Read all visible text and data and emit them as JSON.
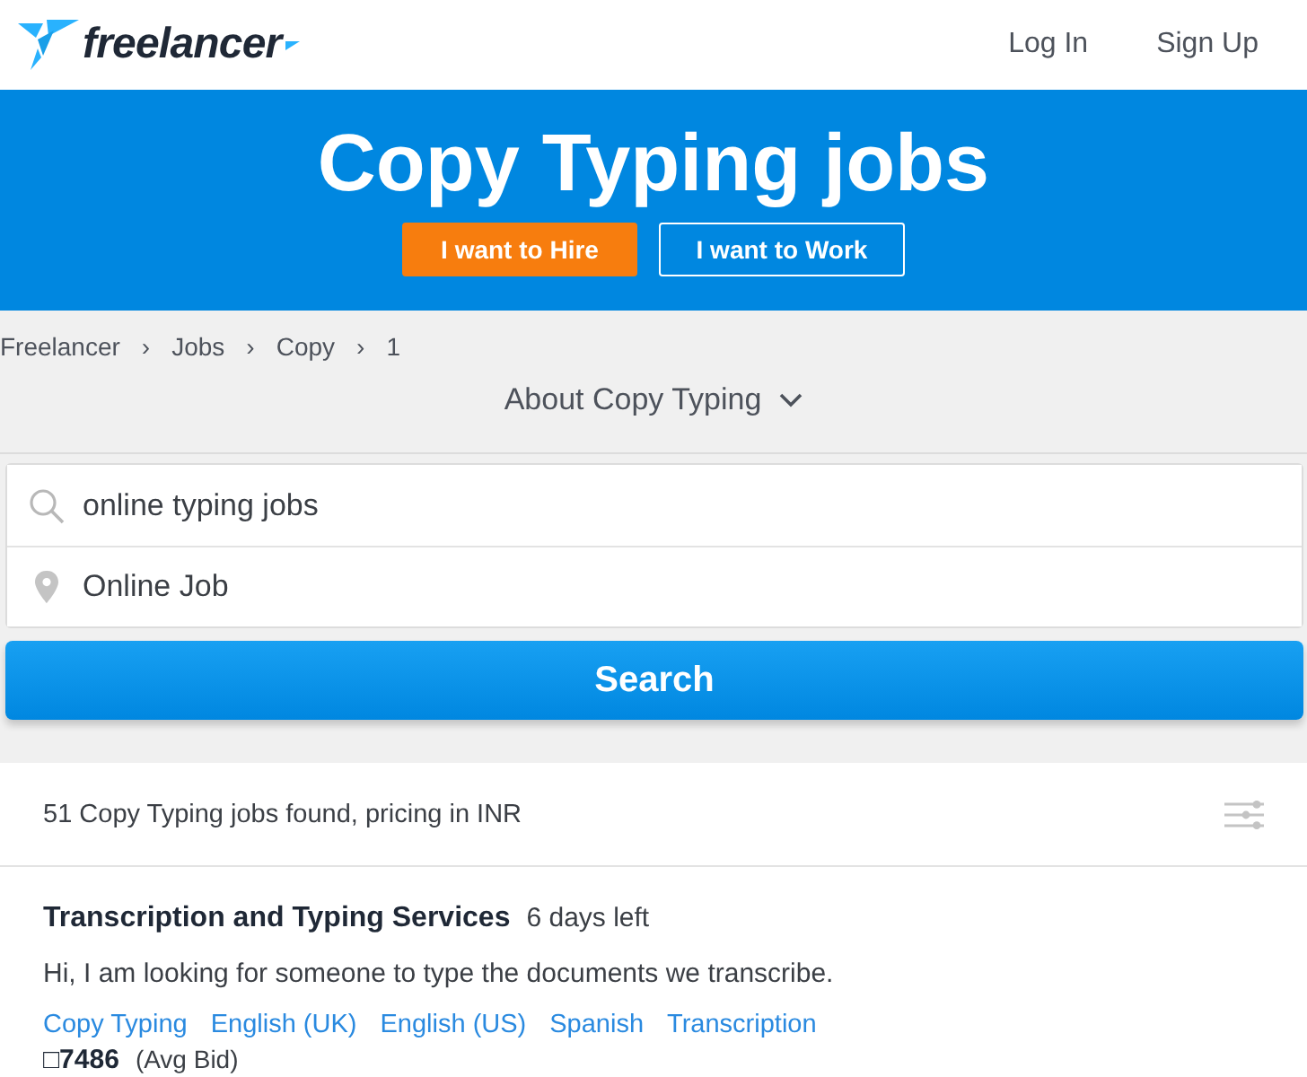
{
  "header": {
    "logo": {
      "wordmark": "freelancer"
    },
    "nav": [
      "Log In",
      "Sign Up"
    ]
  },
  "hero": {
    "title": "Copy Typing jobs",
    "buttons": [
      {
        "label": "I want to Hire",
        "kind": "primary"
      },
      {
        "label": "I want to Work",
        "kind": "outline"
      }
    ]
  },
  "breadcrumb": {
    "separator": "›",
    "items": [
      "Freelancer",
      "Jobs",
      "Copy",
      "1"
    ]
  },
  "about": {
    "label": "About Copy Typing",
    "expanded": false
  },
  "search": {
    "query": {
      "value": "online typing jobs"
    },
    "location": {
      "value": "Online Job"
    },
    "button": "Search"
  },
  "results": {
    "summary": "51 Copy Typing jobs found, pricing in INR"
  },
  "jobs": [
    {
      "title": "Transcription and Typing Services",
      "time_left": "6 days left",
      "description": "Hi, I am looking for someone to type the documents we transcribe.",
      "skills": [
        "Copy Typing",
        "English (UK)",
        "English (US)",
        "Spanish",
        "Transcription"
      ],
      "bid": {
        "amount": "□7486",
        "note": "(Avg Bid)"
      }
    }
  ]
}
